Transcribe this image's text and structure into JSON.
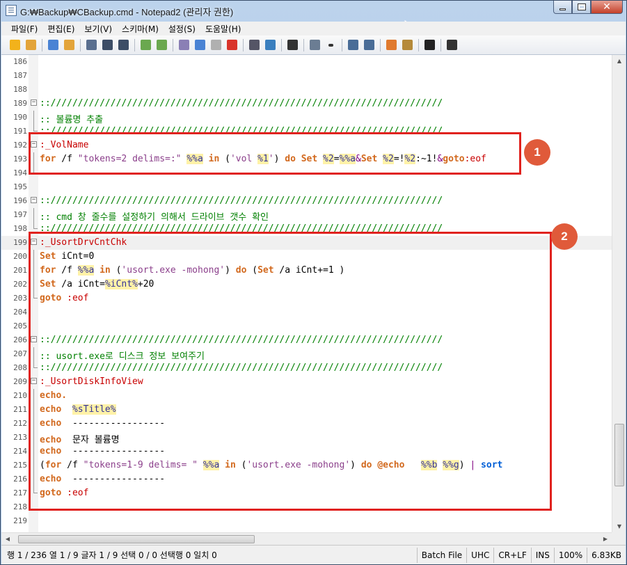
{
  "window": {
    "title": "G:₩Backup₩CBackup.cmd - Notepad2 (관리자 권한)"
  },
  "menu": [
    "파일(F)",
    "편집(E)",
    "보기(V)",
    "스키마(M)",
    "설정(S)",
    "도움말(H)"
  ],
  "toolbar_icons": [
    "new-star-icon",
    "open-folder-icon",
    "sep",
    "new-file-icon",
    "open-file-icon",
    "sep",
    "save-icon",
    "save-as-icon",
    "save-copy-icon",
    "sep",
    "undo-icon",
    "redo-icon",
    "sep",
    "cut-icon",
    "copy-icon",
    "paste-icon",
    "delete-icon",
    "sep",
    "find-icon",
    "replace-icon",
    "sep",
    "word-wrap-icon",
    "sep",
    "list-icon",
    "dropdown-icon",
    "sep",
    "zoom-in-icon",
    "zoom-out-icon",
    "sep",
    "scheme-icon",
    "customize-icon",
    "sep",
    "terminal-icon",
    "sep",
    "exit-icon"
  ],
  "lines": [
    {
      "n": "186",
      "parts": []
    },
    {
      "n": "187",
      "parts": []
    },
    {
      "n": "188",
      "parts": []
    },
    {
      "n": "189",
      "fold": "box",
      "parts": [
        {
          "t": "::////////////////////////////////////////////////////////////////////////",
          "c": "c-green"
        }
      ]
    },
    {
      "n": "190",
      "fold": "line",
      "parts": [
        {
          "t": ":: 볼륨명 추출",
          "c": "c-green"
        }
      ]
    },
    {
      "n": "191",
      "fold": "end",
      "parts": [
        {
          "t": "::////////////////////////////////////////////////////////////////////////",
          "c": "c-green"
        }
      ]
    },
    {
      "n": "192",
      "fold": "box",
      "parts": [
        {
          "t": ":_VolName",
          "c": "c-red"
        }
      ]
    },
    {
      "n": "193",
      "fold": "line",
      "parts": [
        {
          "t": "for",
          "c": "c-kw"
        },
        {
          "t": " /f ",
          "c": ""
        },
        {
          "t": "\"tokens=2 delims=:\"",
          "c": "c-str"
        },
        {
          "t": " ",
          "c": ""
        },
        {
          "t": "%%a",
          "c": "c-var"
        },
        {
          "t": " ",
          "c": ""
        },
        {
          "t": "in",
          "c": "c-kw"
        },
        {
          "t": " (",
          "c": ""
        },
        {
          "t": "'vol ",
          "c": "c-str"
        },
        {
          "t": "%1",
          "c": "c-var"
        },
        {
          "t": "'",
          "c": "c-str"
        },
        {
          "t": ") ",
          "c": ""
        },
        {
          "t": "do",
          "c": "c-kw"
        },
        {
          "t": " ",
          "c": ""
        },
        {
          "t": "Set",
          "c": "c-kw"
        },
        {
          "t": " ",
          "c": ""
        },
        {
          "t": "%2",
          "c": "c-var"
        },
        {
          "t": "=",
          "c": ""
        },
        {
          "t": "%%a",
          "c": "c-var"
        },
        {
          "t": "&",
          "c": "c-op"
        },
        {
          "t": "Set",
          "c": "c-kw"
        },
        {
          "t": " ",
          "c": ""
        },
        {
          "t": "%2",
          "c": "c-var"
        },
        {
          "t": "=!",
          "c": ""
        },
        {
          "t": "%2",
          "c": "c-var"
        },
        {
          "t": ":~1!",
          "c": ""
        },
        {
          "t": "&",
          "c": "c-op"
        },
        {
          "t": "goto",
          "c": "c-kw"
        },
        {
          "t": ":eof",
          "c": "c-red"
        }
      ]
    },
    {
      "n": "194",
      "fold": "end",
      "parts": []
    },
    {
      "n": "195",
      "parts": []
    },
    {
      "n": "196",
      "fold": "box",
      "parts": [
        {
          "t": "::////////////////////////////////////////////////////////////////////////",
          "c": "c-green"
        }
      ]
    },
    {
      "n": "197",
      "fold": "line",
      "parts": [
        {
          "t": ":: cmd 창 줄수를 설정하기 의해서 드라이브 갯수 확인",
          "c": "c-green"
        }
      ]
    },
    {
      "n": "198",
      "fold": "end",
      "parts": [
        {
          "t": "::////////////////////////////////////////////////////////////////////////",
          "c": "c-green"
        }
      ]
    },
    {
      "n": "199",
      "fold": "box",
      "cur": true,
      "parts": [
        {
          "t": ":_UsortDrvCntChk",
          "c": "c-red"
        }
      ]
    },
    {
      "n": "200",
      "fold": "line",
      "parts": [
        {
          "t": "Set",
          "c": "c-kw"
        },
        {
          "t": " iCnt=0",
          "c": ""
        }
      ]
    },
    {
      "n": "201",
      "fold": "line",
      "parts": [
        {
          "t": "for",
          "c": "c-kw"
        },
        {
          "t": " /f ",
          "c": ""
        },
        {
          "t": "%%a",
          "c": "c-var"
        },
        {
          "t": " ",
          "c": ""
        },
        {
          "t": "in",
          "c": "c-kw"
        },
        {
          "t": " (",
          "c": ""
        },
        {
          "t": "'usort.exe -mohong'",
          "c": "c-str"
        },
        {
          "t": ") ",
          "c": ""
        },
        {
          "t": "do",
          "c": "c-kw"
        },
        {
          "t": " (",
          "c": ""
        },
        {
          "t": "Set",
          "c": "c-kw"
        },
        {
          "t": " /a iCnt+=1 )",
          "c": ""
        }
      ]
    },
    {
      "n": "202",
      "fold": "line",
      "parts": [
        {
          "t": "Set",
          "c": "c-kw"
        },
        {
          "t": " /a iCnt=",
          "c": ""
        },
        {
          "t": "%iCnt%",
          "c": "c-var"
        },
        {
          "t": "+20",
          "c": ""
        }
      ]
    },
    {
      "n": "203",
      "fold": "end",
      "parts": [
        {
          "t": "goto",
          "c": "c-kw"
        },
        {
          "t": " :eof",
          "c": "c-red"
        }
      ]
    },
    {
      "n": "204",
      "parts": []
    },
    {
      "n": "205",
      "parts": []
    },
    {
      "n": "206",
      "fold": "box",
      "parts": [
        {
          "t": "::////////////////////////////////////////////////////////////////////////",
          "c": "c-green"
        }
      ]
    },
    {
      "n": "207",
      "fold": "line",
      "parts": [
        {
          "t": ":: usort.exe로 디스크 정보 보여주기",
          "c": "c-green"
        }
      ]
    },
    {
      "n": "208",
      "fold": "end",
      "parts": [
        {
          "t": "::////////////////////////////////////////////////////////////////////////",
          "c": "c-green"
        }
      ]
    },
    {
      "n": "209",
      "fold": "box",
      "parts": [
        {
          "t": ":_UsortDiskInfoView",
          "c": "c-red"
        }
      ]
    },
    {
      "n": "210",
      "fold": "line",
      "parts": [
        {
          "t": "echo.",
          "c": "c-kw"
        }
      ]
    },
    {
      "n": "211",
      "fold": "line",
      "parts": [
        {
          "t": "echo",
          "c": "c-kw"
        },
        {
          "t": "  ",
          "c": ""
        },
        {
          "t": "%sTitle%",
          "c": "c-var"
        }
      ]
    },
    {
      "n": "212",
      "fold": "line",
      "parts": [
        {
          "t": "echo",
          "c": "c-kw"
        },
        {
          "t": "  -----------------",
          "c": ""
        }
      ]
    },
    {
      "n": "213",
      "fold": "line",
      "parts": [
        {
          "t": "echo",
          "c": "c-kw"
        },
        {
          "t": "  문자 볼륨명",
          "c": ""
        }
      ]
    },
    {
      "n": "214",
      "fold": "line",
      "parts": [
        {
          "t": "echo",
          "c": "c-kw"
        },
        {
          "t": "  -----------------",
          "c": ""
        }
      ]
    },
    {
      "n": "215",
      "fold": "line",
      "parts": [
        {
          "t": "(",
          "c": ""
        },
        {
          "t": "for",
          "c": "c-kw"
        },
        {
          "t": " /f ",
          "c": ""
        },
        {
          "t": "\"tokens=1-9 delims= \"",
          "c": "c-str"
        },
        {
          "t": " ",
          "c": ""
        },
        {
          "t": "%%a",
          "c": "c-var"
        },
        {
          "t": " ",
          "c": ""
        },
        {
          "t": "in",
          "c": "c-kw"
        },
        {
          "t": " (",
          "c": ""
        },
        {
          "t": "'usort.exe -mohong'",
          "c": "c-str"
        },
        {
          "t": ") ",
          "c": ""
        },
        {
          "t": "do",
          "c": "c-kw"
        },
        {
          "t": " ",
          "c": ""
        },
        {
          "t": "@echo",
          "c": "c-kw"
        },
        {
          "t": "   ",
          "c": ""
        },
        {
          "t": "%%b",
          "c": "c-var"
        },
        {
          "t": " ",
          "c": ""
        },
        {
          "t": "%%g",
          "c": "c-var"
        },
        {
          "t": ") ",
          "c": ""
        },
        {
          "t": "|",
          "c": "c-op"
        },
        {
          "t": " ",
          "c": ""
        },
        {
          "t": "sort",
          "c": "c-kw2"
        }
      ]
    },
    {
      "n": "216",
      "fold": "line",
      "parts": [
        {
          "t": "echo",
          "c": "c-kw"
        },
        {
          "t": "  -----------------",
          "c": ""
        }
      ]
    },
    {
      "n": "217",
      "fold": "end",
      "parts": [
        {
          "t": "goto",
          "c": "c-kw"
        },
        {
          "t": " :eof",
          "c": "c-red"
        }
      ]
    },
    {
      "n": "218",
      "parts": []
    },
    {
      "n": "219",
      "parts": []
    }
  ],
  "annotations": {
    "badge1": "1",
    "badge2": "2"
  },
  "status": {
    "main": "행 1 / 236  열 1 / 9  글자 1 / 9  선택 0 / 0  선택행 0  일치 0",
    "scheme": "Batch File",
    "encoding": "UHC",
    "eol": "CR+LF",
    "mode": "INS",
    "zoom": "100%",
    "size": "6.83KB"
  },
  "colors": {
    "highlight": "#e0221e",
    "badge": "#e05a3a"
  }
}
